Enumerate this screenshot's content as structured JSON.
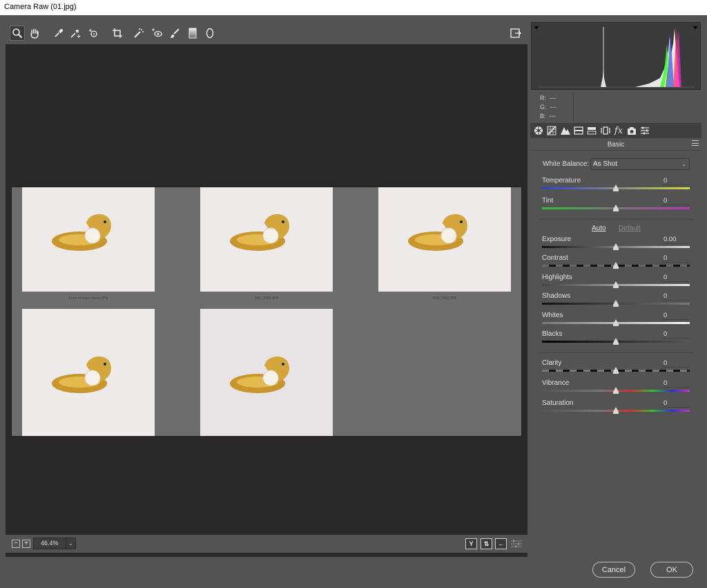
{
  "window": {
    "title": "Camera Raw (01.jpg)"
  },
  "toolbar": {
    "tools": [
      {
        "name": "zoom-tool",
        "icon": "magnifier-icon",
        "active": true
      },
      {
        "name": "hand-tool",
        "icon": "hand-icon"
      },
      {
        "name": "white-balance-tool",
        "icon": "eyedropper-icon"
      },
      {
        "name": "color-sampler-tool",
        "icon": "color-sampler-icon"
      },
      {
        "name": "targeted-adjustment-tool",
        "icon": "target-adjust-icon"
      },
      {
        "name": "crop-tool",
        "icon": "crop-icon"
      },
      {
        "name": "spot-removal-tool",
        "icon": "spot-removal-icon"
      },
      {
        "name": "red-eye-tool",
        "icon": "red-eye-icon"
      },
      {
        "name": "adjustment-brush-tool",
        "icon": "brush-icon"
      },
      {
        "name": "graduated-filter-tool",
        "icon": "gradient-icon"
      },
      {
        "name": "radial-filter-tool",
        "icon": "ellipse-icon"
      }
    ],
    "open_fullscreen_icon": "exit-to-photoshop-icon"
  },
  "filmstrip": {
    "thumbnails": [
      {
        "caption": "Front of ring in focus.JPG"
      },
      {
        "caption": "IMG_3160.JPG"
      },
      {
        "caption": "IMG_3162.JPG"
      },
      {
        "caption": ""
      },
      {
        "caption": ""
      }
    ]
  },
  "bottombar": {
    "zoom_out": "−",
    "zoom_in": "+",
    "zoom_level": "46.4%",
    "view_toggle_y": "Y",
    "view_toggle_swap": "⇅",
    "view_toggle_arrow": "←"
  },
  "histogram": {
    "colors": {
      "red": "#ff3030",
      "green": "#30ff30",
      "blue": "#3050ff",
      "yellow": "#ffff40",
      "white": "#e8e8e8"
    }
  },
  "readout": {
    "r_label": "R:",
    "r_value": "---",
    "g_label": "G:",
    "g_value": "---",
    "b_label": "B:",
    "b_value": "---"
  },
  "panel": {
    "title": "Basic",
    "tabs": [
      "basic-icon",
      "tone-curve-icon",
      "detail-icon",
      "hsl-icon",
      "split-toning-icon",
      "lens-corrections-icon",
      "effects-icon",
      "camera-calibration-icon",
      "presets-icon"
    ],
    "effects_tab_label": "fx",
    "white_balance_label": "White Balance:",
    "white_balance_value": "As Shot",
    "auto_label": "Auto",
    "default_label": "Default",
    "sliders": {
      "temperature": {
        "label": "Temperature",
        "value": "0",
        "level": 0.5
      },
      "tint": {
        "label": "Tint",
        "value": "0",
        "level": 0.5
      },
      "exposure": {
        "label": "Exposure",
        "value": "0.00",
        "level": 0.5
      },
      "contrast": {
        "label": "Contrast",
        "value": "0",
        "level": 0.5
      },
      "highlights": {
        "label": "Highlights",
        "value": "0",
        "level": 0.5
      },
      "shadows": {
        "label": "Shadows",
        "value": "0",
        "level": 0.5
      },
      "whites": {
        "label": "Whites",
        "value": "0",
        "level": 0.5
      },
      "blacks": {
        "label": "Blacks",
        "value": "0",
        "level": 0.5
      },
      "clarity": {
        "label": "Clarity",
        "value": "0",
        "level": 0.5
      },
      "vibrance": {
        "label": "Vibrance",
        "value": "0",
        "level": 0.5
      },
      "saturation": {
        "label": "Saturation",
        "value": "0",
        "level": 0.5
      }
    }
  },
  "dialog": {
    "cancel_label": "Cancel",
    "ok_label": "OK"
  }
}
